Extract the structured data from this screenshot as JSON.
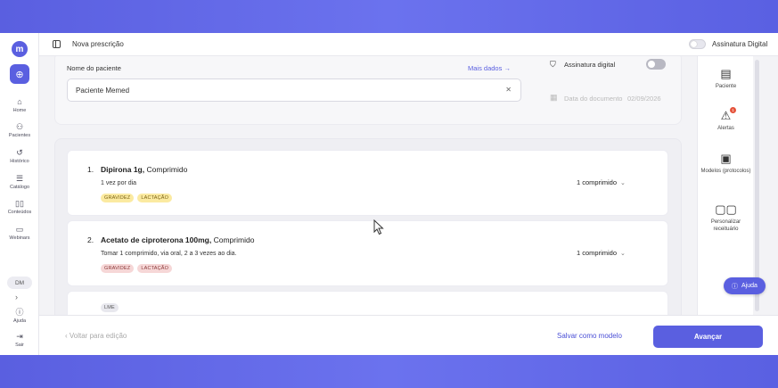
{
  "topbar": {
    "title": "Nova prescrição",
    "digital_signature_label": "Assinatura Digital"
  },
  "rail": {
    "logo_icon": "memed-logo-icon",
    "items": [
      {
        "label": "Home",
        "icon": "home-icon"
      },
      {
        "label": "Pacientes",
        "icon": "users-icon"
      },
      {
        "label": "Histórico",
        "icon": "history-icon"
      },
      {
        "label": "Catálogo",
        "icon": "list-icon"
      },
      {
        "label": "Conteúdos",
        "icon": "book-icon"
      },
      {
        "label": "Webinars",
        "icon": "video-icon"
      }
    ],
    "user_initials": "DM",
    "help_label": "Ajuda",
    "logout_label": "Sair"
  },
  "patient": {
    "name_label": "Nome do paciente",
    "more_data_label": "Mais dados",
    "name_value": "Paciente Memed",
    "signature_label": "Assinatura digital",
    "date_label": "Data do documento",
    "date_value": "02/09/2026"
  },
  "medications": [
    {
      "number": "1.",
      "name": "Dipirona 1g,",
      "form": "Comprimido",
      "dosage": "1 vez por dia",
      "tags": [
        {
          "text": "GRAVIDEZ",
          "color": "yellow"
        },
        {
          "text": "LACTAÇÃO",
          "color": "yellow"
        }
      ],
      "quantity": "1 comprimido"
    },
    {
      "number": "2.",
      "name": "Acetato de ciproterona 100mg,",
      "form": "Comprimido",
      "dosage": "Tomar 1 comprimido, via oral, 2 a 3 vezes ao dia.",
      "tags": [
        {
          "text": "GRAVIDEZ",
          "color": "pink"
        },
        {
          "text": "LACTAÇÃO",
          "color": "pink"
        }
      ],
      "quantity": "1 comprimido"
    },
    {
      "tags": [
        {
          "text": "LME",
          "color": "gray"
        }
      ]
    }
  ],
  "tools": [
    {
      "label": "Paciente",
      "icon": "patient-file-icon"
    },
    {
      "label": "Alertas",
      "icon": "alert-icon",
      "badge": "1"
    },
    {
      "label": "Modelos (protocolos)",
      "icon": "models-icon"
    },
    {
      "label": "Personalizar receituário",
      "icon": "customize-icon"
    }
  ],
  "help_button": "Ajuda",
  "footer": {
    "back_label": "Voltar para edição",
    "save_model_label": "Salvar como modelo",
    "advance_label": "Avançar"
  },
  "colors": {
    "accent": "#5a5fe0",
    "tag_yellow": "#fbeaa1",
    "tag_pink": "#f6d7d7"
  }
}
